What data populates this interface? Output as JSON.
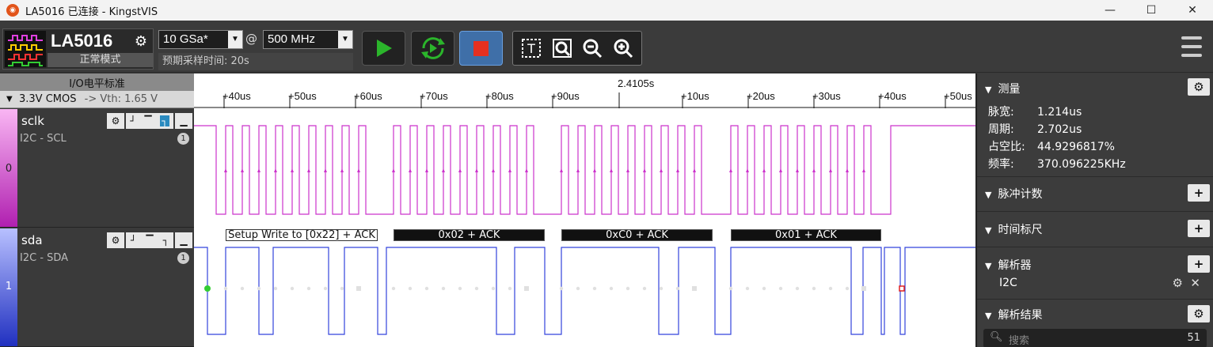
{
  "window": {
    "title": "LA5016 已连接 - KingstVIS",
    "icon_name": "kingst-logo-icon",
    "controls": [
      "minimize-icon",
      "maximize-icon",
      "close-icon"
    ]
  },
  "toolbar": {
    "device_name": "LA5016",
    "device_mode": "正常模式",
    "sample_rate": "10 GSa*",
    "at_symbol": "@",
    "clock": "500 MHz",
    "estimated_time": "预期采样时间: 20s",
    "accent_run": "#2bb52b",
    "accent_stop": "#e53020"
  },
  "io": {
    "title": "I/O电平标准",
    "level": "3.3V CMOS",
    "vth": "-> Vth: 1.65 V"
  },
  "channels": [
    {
      "index": "0",
      "name": "sclk",
      "protocol": "I2C - SCL",
      "badge": "1",
      "color": "#cc33cc"
    },
    {
      "index": "1",
      "name": "sda",
      "protocol": "I2C - SDA",
      "badge": "1",
      "color": "#3344dd"
    }
  ],
  "ruler": {
    "center": "2.4105s",
    "left_labels": [
      "+40us",
      "+50us",
      "+60us",
      "+70us",
      "+80us",
      "+90us"
    ],
    "right_labels": [
      "+10us",
      "+20us",
      "+30us",
      "+40us",
      "+50us"
    ]
  },
  "decode": {
    "frames": [
      "Setup Write to [0x22] + ACK",
      "0x02 + ACK",
      "0xC0 + ACK",
      "0x01 + ACK"
    ]
  },
  "measure": {
    "title": "测量",
    "rows": [
      {
        "key": "脉宽:",
        "value": "1.214us"
      },
      {
        "key": "周期:",
        "value": "2.702us"
      },
      {
        "key": "占空比:",
        "value": "44.9296817%"
      },
      {
        "key": "频率:",
        "value": "370.096225KHz"
      }
    ]
  },
  "pulse_count": {
    "title": "脉冲计数"
  },
  "time_ruler": {
    "title": "时间标尺"
  },
  "analyzer": {
    "title": "解析器",
    "item": "I2C"
  },
  "results": {
    "title": "解析结果",
    "search_placeholder": "搜索",
    "count": "51"
  }
}
